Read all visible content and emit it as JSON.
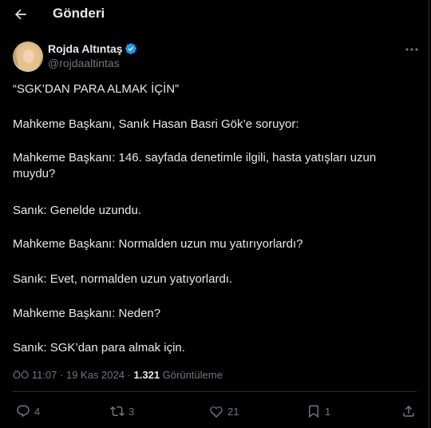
{
  "header": {
    "title": "Gönderi"
  },
  "author": {
    "name": "Rojda Altıntaş",
    "handle": "@rojdaaltintas"
  },
  "tweet": {
    "lines": [
      "“SGK’DAN PARA ALMAK İÇİN”",
      "Mahkeme Başkanı, Sanık Hasan Basri Gök’e soruyor:",
      "Mahkeme Başkanı: 146. sayfada denetimle ilgili, hasta yatışları uzun muydu?",
      "Sanık: Genelde uzundu.",
      "Mahkeme Başkanı: Normalden uzun mu yatırıyorlardı?",
      "Sanık: Evet, normalden uzun yatıyorlardı.",
      "Mahkeme Başkanı: Neden?",
      "Sanık: SGK’dan para almak için."
    ]
  },
  "meta": {
    "time": "ÖÖ 11:07 · 19 Kas 2024 · ",
    "views": "1.321",
    "views_label": " Görüntüleme"
  },
  "actions": {
    "replies": "4",
    "reposts": "3",
    "likes": "21",
    "bookmarks": "1"
  },
  "colors": {
    "background": "#000000",
    "text": "#e7e9ea",
    "muted": "#71767b",
    "verified": "#1d9bf0",
    "divider": "#2f3336"
  }
}
